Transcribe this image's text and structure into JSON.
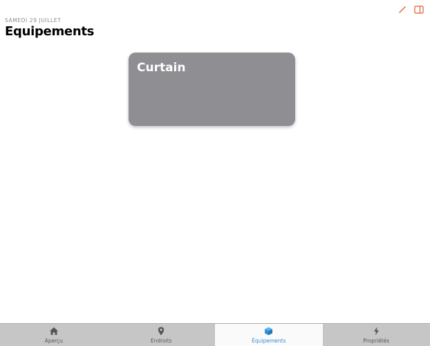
{
  "header": {
    "date": "SAMEDI 29 JUILLET",
    "title": "Equipements"
  },
  "top_actions": [
    {
      "name": "edit-icon",
      "color": "#e05a2b"
    },
    {
      "name": "sidebar-toggle-icon",
      "color": "#e05a2b"
    }
  ],
  "cards": [
    {
      "title": "Curtain",
      "color": "#8e8e93"
    }
  ],
  "tabbar": {
    "tabs": [
      {
        "label": "Aperçu",
        "icon": "home-icon",
        "active": false
      },
      {
        "label": "Endroits",
        "icon": "location-pin-icon",
        "active": false
      },
      {
        "label": "Équipements",
        "icon": "cube-icon",
        "active": true
      },
      {
        "label": "Propriétés",
        "icon": "bolt-icon",
        "active": false
      }
    ],
    "active_color": "#2f8fd6"
  }
}
